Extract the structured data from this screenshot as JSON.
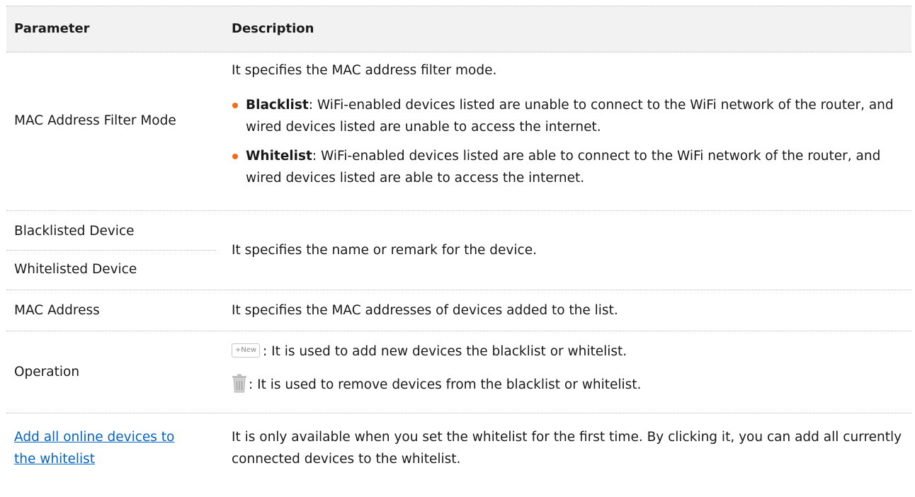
{
  "header": {
    "parameter": "Parameter",
    "description": "Description"
  },
  "rows": {
    "mac_filter_mode": {
      "param": "MAC Address Filter Mode",
      "intro": "It specifies the MAC address filter mode.",
      "blacklist_term": "Blacklist",
      "blacklist_text": ": WiFi-enabled devices listed are unable to connect to the WiFi network of the router, and wired devices listed are unable to access the internet.",
      "whitelist_term": "Whitelist",
      "whitelist_text": ": WiFi-enabled devices listed are able to connect to the WiFi network of the router, and wired devices listed are able to access the internet."
    },
    "device": {
      "param_blacklisted": "Blacklisted Device",
      "param_whitelisted": "Whitelisted Device",
      "desc": "It specifies the name or remark for the device."
    },
    "mac_address": {
      "param": "MAC Address",
      "desc": "It specifies the MAC addresses of devices added to the list."
    },
    "operation": {
      "param": "Operation",
      "new_button": "+New",
      "new_desc": ": It is used to add new devices the blacklist or whitelist.",
      "delete_icon": "trash-icon",
      "delete_desc": ": It is used to remove devices from the blacklist or whitelist."
    },
    "add_all": {
      "param_link": "Add all online devices to the whitelist",
      "desc": "It is only available when you set the whitelist for the first time. By clicking it, you can add all currently connected devices to the whitelist."
    }
  },
  "colors": {
    "header_bg": "#f2f2f2",
    "bullet": "#f26c1a",
    "link": "#0563c1",
    "border": "#b8b8b8"
  }
}
